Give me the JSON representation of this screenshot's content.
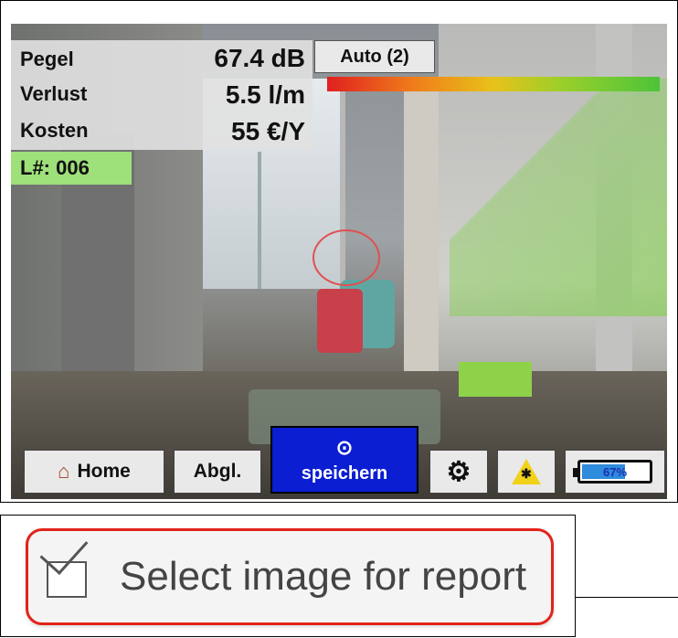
{
  "readout": {
    "rows": [
      {
        "label": "Pegel",
        "value": "67.4 dB"
      },
      {
        "label": "Verlust",
        "value": "5.5 l/m"
      },
      {
        "label": "Kosten",
        "value": "55 €/Y"
      }
    ],
    "leak_id": "L#: 006"
  },
  "mode": {
    "auto_label": "Auto (2)"
  },
  "level_bar": {
    "colors": [
      "#e02020",
      "#ef7a1a",
      "#e8c21a",
      "#9ccf2a",
      "#4cc43a"
    ]
  },
  "toolbar": {
    "home_label": "Home",
    "home_icon": "house-icon",
    "abgl_label": "Abgl.",
    "save_label": "speichern",
    "save_icon": "camera-icon",
    "settings_icon": "gear-icon",
    "laser_icon": "laser-warning-icon",
    "battery_label": "67%",
    "battery_level": 0.67,
    "save_color": "#0b1ed2"
  },
  "report": {
    "select_label": "Select image for report",
    "select_icon": "checkbox-icon",
    "highlight_color": "#e2231a"
  }
}
